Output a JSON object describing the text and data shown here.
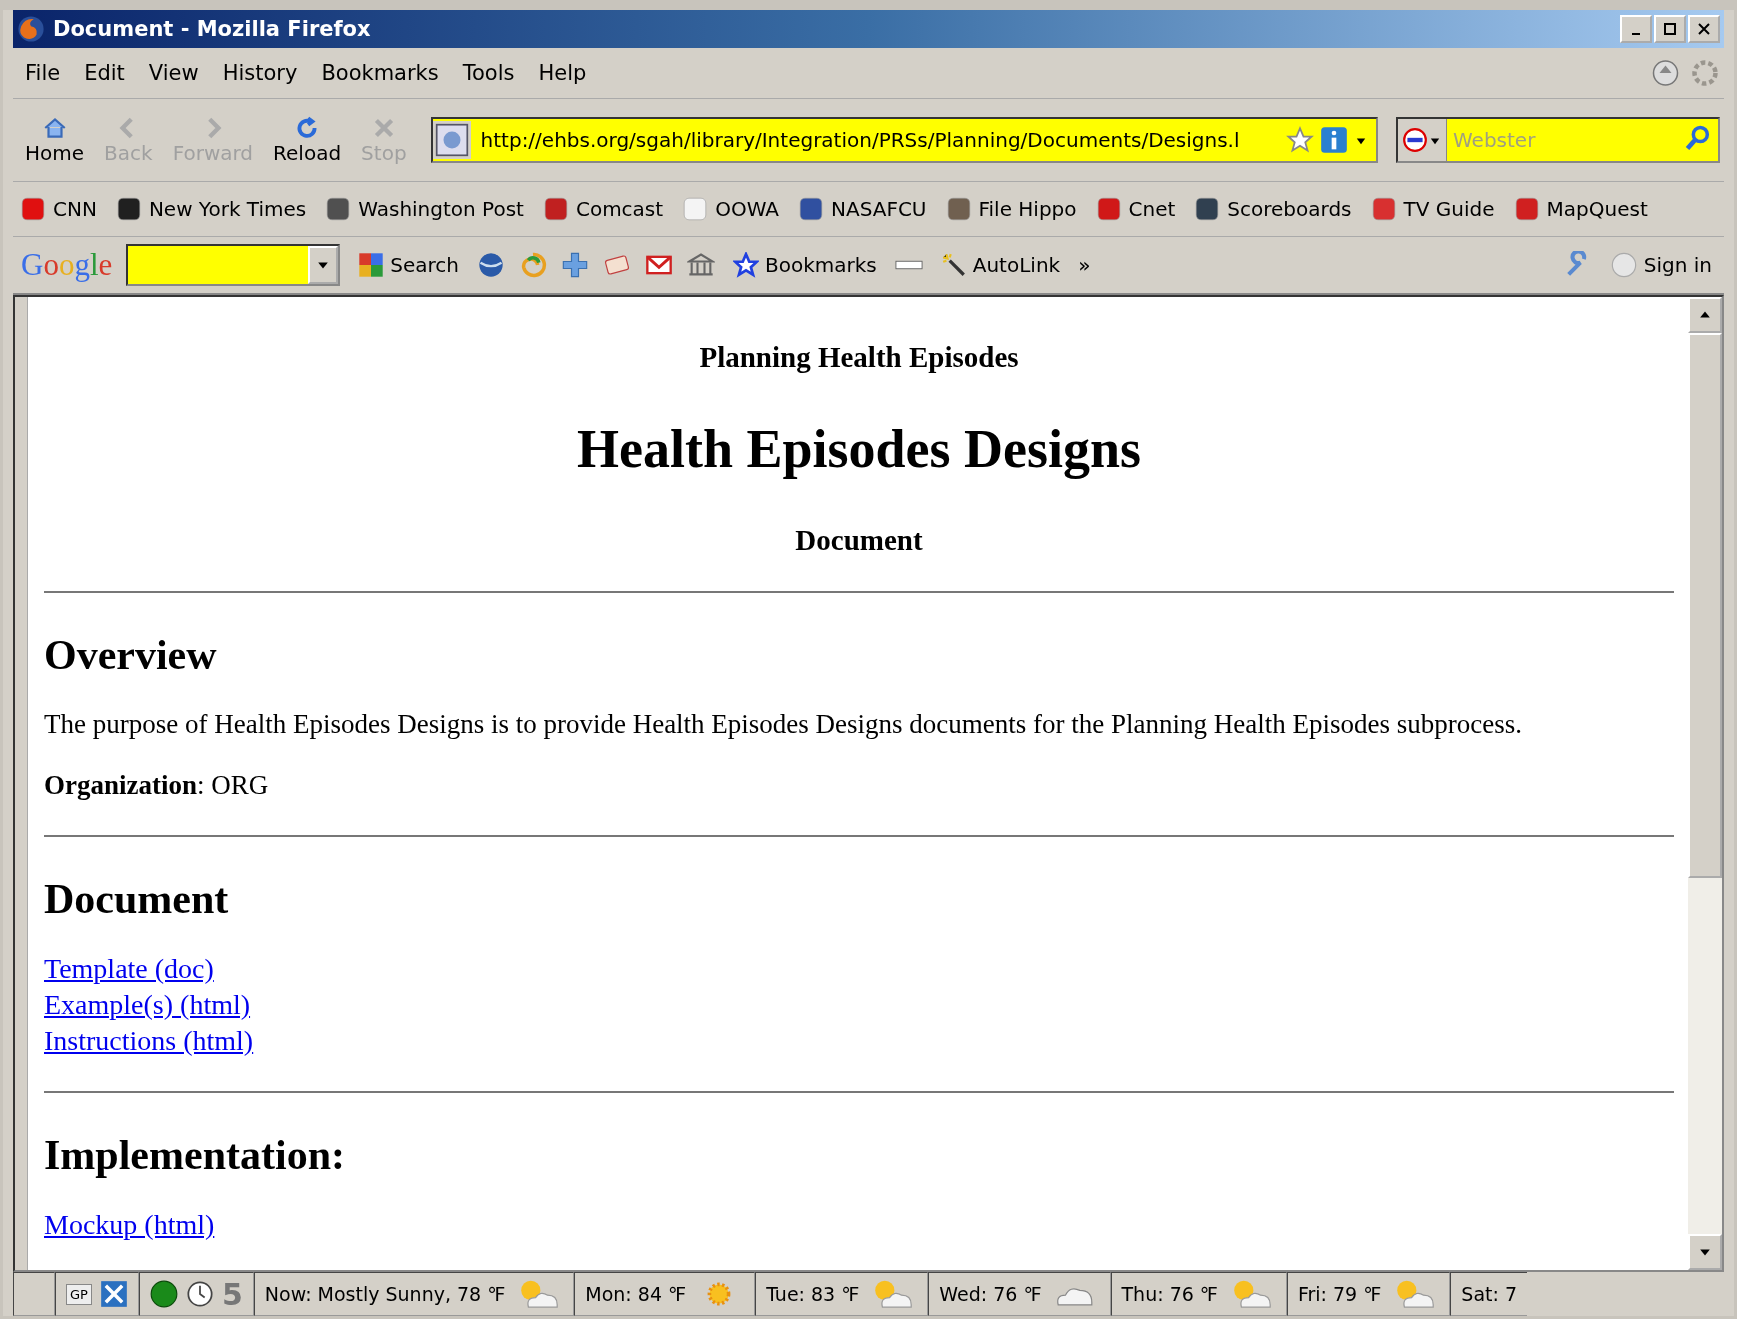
{
  "window": {
    "title": "Document - Mozilla Firefox"
  },
  "menu": [
    "File",
    "Edit",
    "View",
    "History",
    "Bookmarks",
    "Tools",
    "Help"
  ],
  "nav_buttons": [
    {
      "kind": "home",
      "label": "Home",
      "disabled": false
    },
    {
      "kind": "back",
      "label": "Back",
      "disabled": true
    },
    {
      "kind": "forward",
      "label": "Forward",
      "disabled": true
    },
    {
      "kind": "reload",
      "label": "Reload",
      "disabled": false
    },
    {
      "kind": "stop",
      "label": "Stop",
      "disabled": true
    }
  ],
  "address": {
    "value": "http://ehbs.org/sgah/library/Integration/PRSs/Planning/Documents/Designs.l"
  },
  "search": {
    "placeholder": "Webster"
  },
  "bookmarks": [
    {
      "label": "CNN",
      "color": "#e01010"
    },
    {
      "label": "New York Times",
      "color": "#202020"
    },
    {
      "label": "Washington Post",
      "color": "#505050"
    },
    {
      "label": "Comcast",
      "color": "#c02020"
    },
    {
      "label": "OOWA",
      "color": "#f4f4f4"
    },
    {
      "label": "NASAFCU",
      "color": "#3050a0"
    },
    {
      "label": "File Hippo",
      "color": "#706050"
    },
    {
      "label": "Cnet",
      "color": "#d01818"
    },
    {
      "label": "Scoreboards",
      "color": "#304050"
    },
    {
      "label": "TV Guide",
      "color": "#d83030"
    },
    {
      "label": "MapQuest",
      "color": "#d02020"
    }
  ],
  "google_bar": {
    "logo": "Google",
    "search_label": "Search",
    "bookmarks_label": "Bookmarks",
    "autolink_label": "AutoLink",
    "more": "»",
    "sign_in": "Sign in"
  },
  "page": {
    "subtitle": "Planning Health Episodes",
    "title": "Health Episodes Designs",
    "doc_label": "Document",
    "sections": [
      {
        "heading": "Overview",
        "paragraphs": [
          "The purpose of Health Episodes Designs is to provide Health Episodes Designs documents for the Planning Health Episodes subprocess.",
          "**Organization**: ORG"
        ]
      },
      {
        "heading": "Document",
        "links": [
          "Template (doc)",
          "Example(s) (html)",
          "Instructions (html)"
        ]
      },
      {
        "heading": "Implementation:",
        "links": [
          "Mockup (html)"
        ]
      }
    ]
  },
  "status_bar": {
    "gp": "GP",
    "count": "5",
    "weather": [
      {
        "text": "Now: Mostly Sunny, 78 ℉",
        "kind": "partly"
      },
      {
        "text": "Mon: 84 ℉",
        "kind": "sunny"
      },
      {
        "text": "Tue: 83 ℉",
        "kind": "partly"
      },
      {
        "text": "Wed: 76 ℉",
        "kind": "cloudy"
      },
      {
        "text": "Thu: 76 ℉",
        "kind": "partly"
      },
      {
        "text": "Fri: 79 ℉",
        "kind": "partly"
      },
      {
        "text": "Sat: 7",
        "kind": "none"
      }
    ]
  }
}
